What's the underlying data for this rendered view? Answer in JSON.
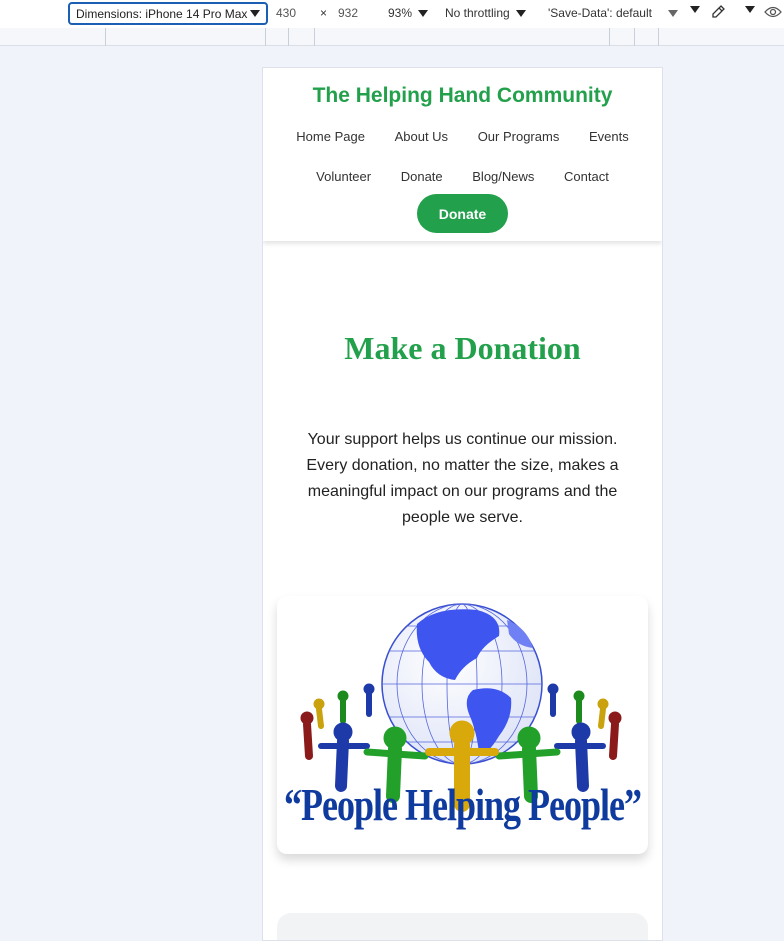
{
  "devtools": {
    "dimensions_label": "Dimensions: iPhone 14 Pro Max",
    "width": "430",
    "times": "×",
    "height": "932",
    "zoom": "93%",
    "throttling": "No throttling",
    "save_data": "'Save-Data': default"
  },
  "site": {
    "title": "The Helping Hand Community",
    "nav_row1": [
      "Home Page",
      "About Us",
      "Our Programs",
      "Events"
    ],
    "nav_row2": [
      "Volunteer",
      "Donate",
      "Blog/News",
      "Contact"
    ],
    "donate_button": "Donate"
  },
  "main": {
    "heading": "Make a Donation",
    "description": "Your support helps us continue our mission. Every donation, no matter the size, makes a meaningful impact on our programs and the people we serve.",
    "logo_slogan": "“People Helping People”"
  },
  "colors": {
    "brand_green": "#22a04b",
    "slogan_blue": "#0f3a9e"
  }
}
